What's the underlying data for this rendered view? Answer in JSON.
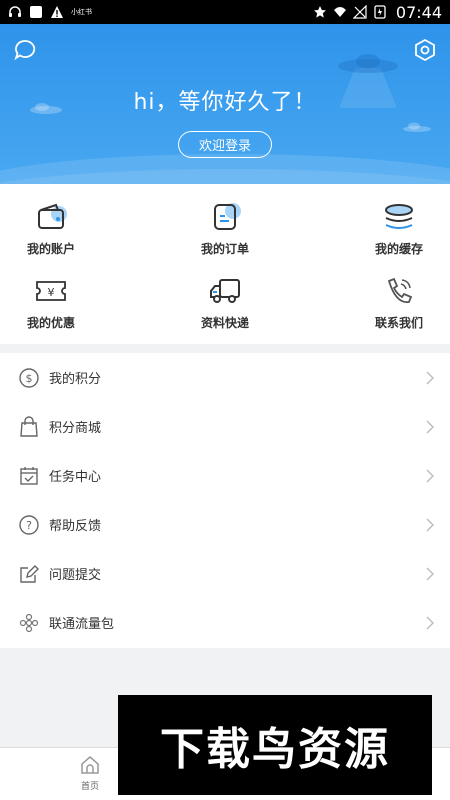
{
  "status_bar": {
    "time": "07:44",
    "small_app_label": "小红书",
    "left_icons": [
      "headset-icon",
      "square-app-icon",
      "warning-icon"
    ],
    "right_icons": [
      "star-icon",
      "wifi-icon",
      "no-signal-icon",
      "battery-icon"
    ]
  },
  "header": {
    "greeting": "hi，等你好久了！",
    "login_button": "欢迎登录",
    "left_icon": "chat-bubble-icon",
    "right_icon": "hexagon-settings-icon",
    "gradient_top": "#2e93ea",
    "gradient_bottom": "#49a8f1"
  },
  "shortcuts": [
    {
      "label": "我的账户",
      "icon": "wallet-icon"
    },
    {
      "label": "我的订单",
      "icon": "order-icon"
    },
    {
      "label": "我的缓存",
      "icon": "cache-stack-icon"
    },
    {
      "label": "我的优惠",
      "icon": "coupon-icon"
    },
    {
      "label": "资料快递",
      "icon": "delivery-truck-icon"
    },
    {
      "label": "联系我们",
      "icon": "phone-icon"
    }
  ],
  "menu": [
    {
      "label": "我的积分",
      "icon": "coin-icon"
    },
    {
      "label": "积分商城",
      "icon": "shopping-bag-icon"
    },
    {
      "label": "任务中心",
      "icon": "calendar-check-icon"
    },
    {
      "label": "帮助反馈",
      "icon": "question-icon"
    },
    {
      "label": "问题提交",
      "icon": "edit-icon"
    },
    {
      "label": "联通流量包",
      "icon": "unicom-icon"
    }
  ],
  "tabbar": {
    "home_label": "首页"
  },
  "watermark": {
    "text": "下载鸟资源"
  },
  "colors": {
    "accent": "#2e93ea",
    "icon_blue": "#5aaaf0",
    "text": "#333333",
    "background": "#f1f2f4"
  }
}
